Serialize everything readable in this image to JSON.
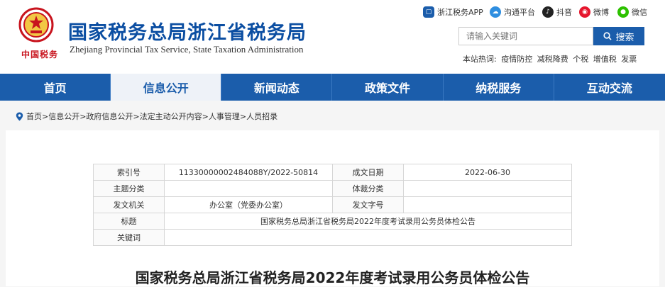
{
  "header": {
    "title": "国家税务总局浙江省税务局",
    "subtitle": "Zhejiang Provincial Tax Service, State Taxation Administration",
    "slogan": "中国税务"
  },
  "social": [
    {
      "label": "浙江税务APP",
      "icon": "app-icon",
      "color": "#1b5dab"
    },
    {
      "label": "沟通平台",
      "icon": "cloud-icon",
      "color": "#2e8ee0"
    },
    {
      "label": "抖音",
      "icon": "tiktok-icon",
      "color": "#222222"
    },
    {
      "label": "微博",
      "icon": "weibo-icon",
      "color": "#e6162d"
    },
    {
      "label": "微信",
      "icon": "wechat-icon",
      "color": "#2dc100"
    }
  ],
  "search": {
    "placeholder": "请输入关键词",
    "button_label": "搜索"
  },
  "hot": {
    "label": "本站热词:",
    "terms": [
      "疫情防控",
      "减税降费",
      "个税",
      "增值税",
      "发票"
    ]
  },
  "nav": {
    "items": [
      {
        "label": "首页"
      },
      {
        "label": "信息公开"
      },
      {
        "label": "新闻动态"
      },
      {
        "label": "政策文件"
      },
      {
        "label": "纳税服务"
      },
      {
        "label": "互动交流"
      }
    ],
    "active_index": 1
  },
  "breadcrumb": "首页>信息公开>政府信息公开>法定主动公开内容>人事管理>人员招录",
  "meta": {
    "index_label": "索引号",
    "index_value": "11330000002484088Y/2022-50814",
    "date_label": "成文日期",
    "date_value": "2022-06-30",
    "topic_label": "主题分类",
    "topic_value": "",
    "genre_label": "体裁分类",
    "genre_value": "",
    "issuer_label": "发文机关",
    "issuer_value": "办公室（党委办公室）",
    "docno_label": "发文字号",
    "docno_value": "",
    "title_label": "标题",
    "title_value": "国家税务总局浙江省税务局2022年度考试录用公务员体检公告",
    "keywords_label": "关键词",
    "keywords_value": ""
  },
  "article": {
    "title": "国家税务总局浙江省税务局2022年度考试录用公务员体检公告"
  },
  "colors": {
    "brand_blue": "#1b5dab",
    "title_blue": "#0b4ea2",
    "emblem_red": "#c8141e"
  }
}
